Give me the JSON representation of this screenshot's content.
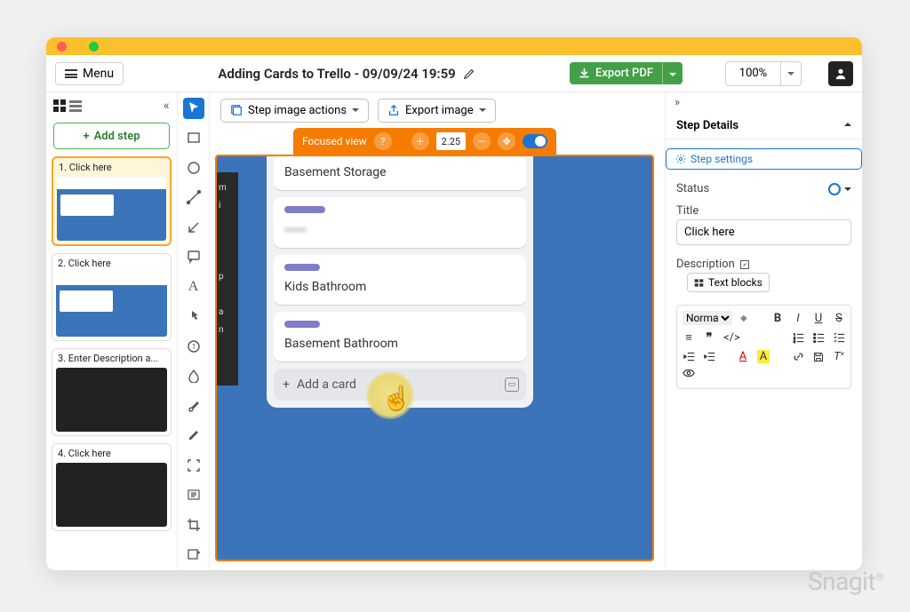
{
  "header": {
    "menu_label": "Menu",
    "doc_title": "Adding Cards to Trello - 09/09/24 19:59",
    "export_label": "Export PDF",
    "zoom": "100%"
  },
  "sidebar": {
    "add_step": "Add step",
    "steps": [
      {
        "label": "1. Click here",
        "selected": true,
        "thumb": "blue"
      },
      {
        "label": "2. Click here",
        "selected": false,
        "thumb": "blue",
        "badge": true
      },
      {
        "label": "3. Enter Description a...",
        "selected": false,
        "thumb": "dark"
      },
      {
        "label": "4. Click here",
        "selected": false,
        "thumb": "dark"
      }
    ]
  },
  "canvas": {
    "step_image_actions": "Step image actions",
    "export_image": "Export image",
    "focused_view": "Focused view",
    "focus_zoom": "2.25",
    "trello": {
      "cards": [
        {
          "title": "Basement Storage",
          "tag": false
        },
        {
          "title": "▪▪▪▪▪",
          "tag": true,
          "blur": true
        },
        {
          "title": "Kids Bathroom",
          "tag": true
        },
        {
          "title": "Basement Bathroom",
          "tag": true
        }
      ],
      "add_card": "Add a card"
    }
  },
  "right": {
    "heading": "Step Details",
    "settings": "Step settings",
    "status_label": "Status",
    "title_label": "Title",
    "title_value": "Click here",
    "desc_label": "Description",
    "text_blocks": "Text blocks",
    "format": "Normal"
  },
  "watermark": "Snagit"
}
